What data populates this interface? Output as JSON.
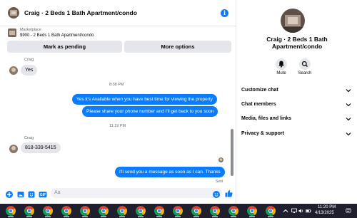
{
  "header": {
    "title": "Craig · 2 Beds 1 Bath Apartment/condo",
    "info_icon_glyph": "i"
  },
  "marketplace": {
    "label": "Marketplace",
    "description": "$900 - 2 Beds 1 Bath Apartment/condo"
  },
  "actions": {
    "mark_pending": "Mark as pending",
    "more_options": "More options"
  },
  "messages": {
    "sender1": "Craig",
    "msg1": "Yes",
    "time1": "8:38 PM",
    "out1": "Yes it's Available when you have best time for viewing the property",
    "out2": "Please share your phone number and I'll get back to you soon",
    "time2": "11:19 PM",
    "sender2": "Craig",
    "msg2": "818-339-5415",
    "out3": "I'll send you a message as soon as I can. Thanks",
    "sent_label": "Sent"
  },
  "composer": {
    "placeholder": "Aa",
    "icons": [
      "plus-icon",
      "image-icon",
      "sticker-icon",
      "gif-icon",
      "emoji-icon",
      "like-icon"
    ]
  },
  "info_panel": {
    "title": "Craig · 2 Beds 1 Bath Apartment/condo",
    "mute_label": "Mute",
    "search_label": "Search",
    "sections": [
      "Customize chat",
      "Chat members",
      "Media, files and links",
      "Privacy & support"
    ]
  },
  "taskbar": {
    "time": "11:20 PM",
    "date": "4/13/2025"
  },
  "colors": {
    "accent": "#0a7cff",
    "bubble_in": "#e4e6eb",
    "taskbar": "#1f1f2e"
  }
}
